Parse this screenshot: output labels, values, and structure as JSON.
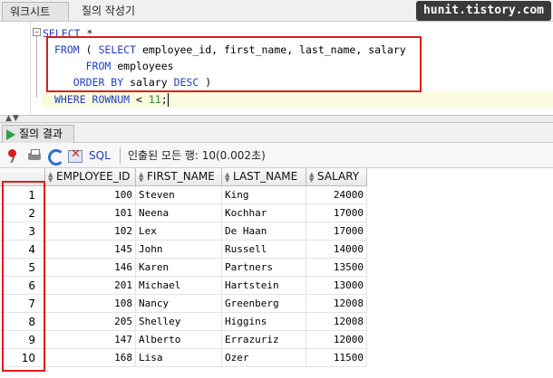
{
  "tabs": {
    "worksheet": "워크시트",
    "query_builder": "질의 작성기"
  },
  "watermark": "hunit.tistory.com",
  "editor": {
    "fold_symbol": "−",
    "lines": [
      [
        {
          "t": "SELECT",
          "c": "kw"
        },
        {
          "t": " *",
          "c": "plain"
        }
      ],
      [
        {
          "t": "FROM",
          "c": "kw"
        },
        {
          "t": " ( ",
          "c": "plain"
        },
        {
          "t": "SELECT",
          "c": "kw"
        },
        {
          "t": " employee_id, first_name, last_name, salary",
          "c": "plain"
        }
      ],
      [
        {
          "t": "     FROM",
          "c": "kw"
        },
        {
          "t": " employees",
          "c": "plain"
        }
      ],
      [
        {
          "t": "   ORDER BY",
          "c": "kw"
        },
        {
          "t": " salary ",
          "c": "plain"
        },
        {
          "t": "DESC",
          "c": "kw"
        },
        {
          "t": " )",
          "c": "plain"
        }
      ],
      [
        {
          "t": "WHERE ROWNUM",
          "c": "kw"
        },
        {
          "t": " < ",
          "c": "plain"
        },
        {
          "t": "11",
          "c": "num"
        },
        {
          "t": ";",
          "c": "plain"
        }
      ]
    ]
  },
  "result_tab": {
    "label": "질의 결과"
  },
  "toolbar": {
    "sql_label": "SQL",
    "status": "인출된 모든 행: 10(0.002초)"
  },
  "grid": {
    "columns": [
      "EMPLOYEE_ID",
      "FIRST_NAME",
      "LAST_NAME",
      "SALARY"
    ],
    "rows": [
      {
        "n": "1",
        "id": "100",
        "first": "Steven",
        "last": "King",
        "salary": "24000"
      },
      {
        "n": "2",
        "id": "101",
        "first": "Neena",
        "last": "Kochhar",
        "salary": "17000"
      },
      {
        "n": "3",
        "id": "102",
        "first": "Lex",
        "last": "De Haan",
        "salary": "17000"
      },
      {
        "n": "4",
        "id": "145",
        "first": "John",
        "last": "Russell",
        "salary": "14000"
      },
      {
        "n": "5",
        "id": "146",
        "first": "Karen",
        "last": "Partners",
        "salary": "13500"
      },
      {
        "n": "6",
        "id": "201",
        "first": "Michael",
        "last": "Hartstein",
        "salary": "13000"
      },
      {
        "n": "7",
        "id": "108",
        "first": "Nancy",
        "last": "Greenberg",
        "salary": "12008"
      },
      {
        "n": "8",
        "id": "205",
        "first": "Shelley",
        "last": "Higgins",
        "salary": "12008"
      },
      {
        "n": "9",
        "id": "147",
        "first": "Alberto",
        "last": "Errazuriz",
        "salary": "12000"
      },
      {
        "n": "10",
        "id": "168",
        "first": "Lisa",
        "last": "Ozer",
        "salary": "11500"
      }
    ]
  },
  "colors": {
    "keyword": "#1f3fbf",
    "number": "#2f8a2f",
    "highlight_box": "#e01b1b"
  }
}
